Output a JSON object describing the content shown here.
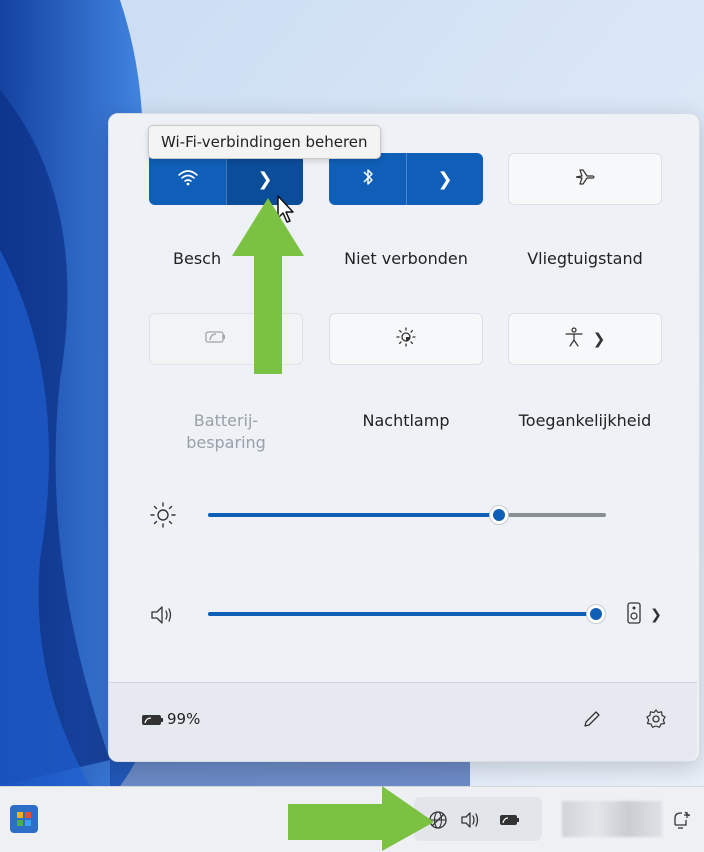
{
  "tooltip": {
    "text": "Wi-Fi-verbindingen beheren"
  },
  "tiles": [
    {
      "id": "wifi",
      "label": "Beschikbaar",
      "state": "on",
      "icon": "wifi-icon",
      "has_arrow": true
    },
    {
      "id": "bluetooth",
      "label": "Niet verbonden",
      "state": "on",
      "icon": "bluetooth-icon",
      "has_arrow": true
    },
    {
      "id": "airplane",
      "label": "Vliegtuigstand",
      "state": "off",
      "icon": "airplane-icon"
    },
    {
      "id": "battery-saver",
      "label_line1": "Batterij-",
      "label_line2": "besparing",
      "state": "disabled",
      "icon": "battery-saver-icon"
    },
    {
      "id": "night-light",
      "label": "Nachtlamp",
      "state": "off",
      "icon": "night-light-icon"
    },
    {
      "id": "accessibility",
      "label": "Toegankelijkheid",
      "state": "off",
      "icon": "accessibility-icon",
      "has_arrow": true
    }
  ],
  "wifi_label_visible": "Besch",
  "sliders": {
    "brightness": {
      "icon": "brightness-icon",
      "value_percent": 67
    },
    "volume": {
      "icon": "speaker-icon",
      "value_percent": 100,
      "output_icon": "audio-output-icon"
    }
  },
  "footer": {
    "battery_text": "99%",
    "edit_icon": "pencil-icon",
    "settings_icon": "gear-icon"
  },
  "taskbar": {
    "start_icon": "start-icon",
    "tray_icons": [
      "network-icon",
      "volume-icon",
      "battery-icon"
    ],
    "notification_icon": "notification-icon"
  },
  "colors": {
    "accent": "#0f5fb8",
    "annotation_arrow": "#7cc242"
  }
}
